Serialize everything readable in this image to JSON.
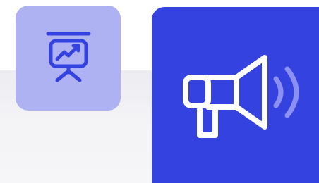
{
  "tiles": [
    {
      "icon": "presentation-chart-icon",
      "background_color": "#aeb2f2",
      "icon_color": "#3442e0"
    },
    {
      "icon": "megaphone-icon",
      "background_color": "#3442e0",
      "icon_color": "#ffffff",
      "sound_wave_color": "#8b90f2"
    }
  ]
}
